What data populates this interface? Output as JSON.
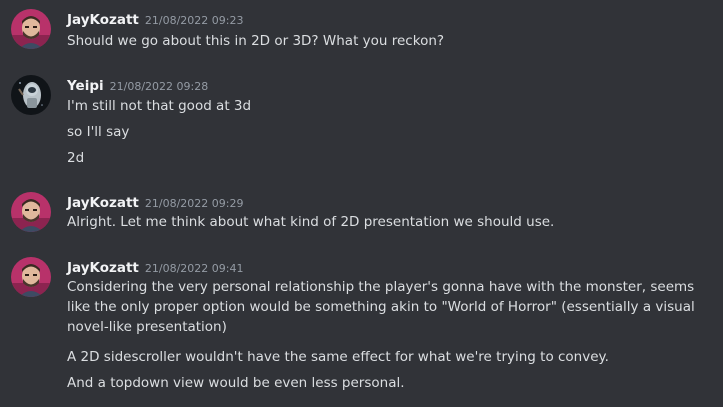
{
  "messages": [
    {
      "author": "JayKozatt",
      "timestamp": "21/08/2022 09:23",
      "avatar": "jaykozatt-avatar",
      "lines": [
        "Should we go about this in 2D or 3D? What you reckon?"
      ]
    },
    {
      "author": "Yeipi",
      "timestamp": "21/08/2022 09:28",
      "avatar": "yeipi-astronaut-avatar",
      "lines": [
        "I'm still not that good at 3d",
        "so I'll say",
        "2d"
      ]
    },
    {
      "author": "JayKozatt",
      "timestamp": "21/08/2022 09:29",
      "avatar": "jaykozatt-avatar",
      "lines": [
        "Alright. Let me think about what kind of 2D presentation we should use."
      ]
    },
    {
      "author": "JayKozatt",
      "timestamp": "21/08/2022 09:41",
      "avatar": "jaykozatt-avatar",
      "lines": [
        "Considering the very personal relationship the player's gonna have with the monster, seems like the only proper option would be something akin to \"World of Horror\" (essentially a visual novel-like presentation)",
        "A 2D sidescroller wouldn't have the same effect for what we're trying to convey.",
        "And a topdown view would be even less personal."
      ]
    }
  ],
  "colors": {
    "background": "#313338",
    "text": "#dbdee1",
    "username": "#f2f3f5",
    "timestamp": "#949ba4"
  }
}
